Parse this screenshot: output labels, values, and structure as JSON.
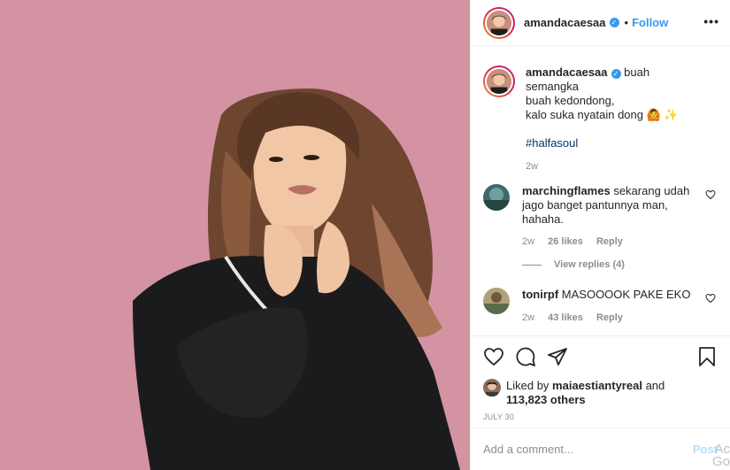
{
  "post": {
    "username": "amandacaesaa",
    "follow_label": "Follow",
    "dot": "•",
    "more_label": "•••",
    "verified_mark": "✓"
  },
  "caption": {
    "username": "amandacaesaa",
    "lines": [
      "buah semangka",
      "buah kedondong,",
      "kalo suka nyatain dong 🙆 ✨"
    ],
    "hashtag": "#halfasoul",
    "time": "2w"
  },
  "comments": [
    {
      "username": "marchingflames",
      "text": "sekarang udah jago banget pantunnya man, hahaha.",
      "time": "2w",
      "likes": "26 likes",
      "reply_label": "Reply",
      "view_replies": "View replies (4)"
    },
    {
      "username": "tonirpf",
      "text": "MASOOOOK PAKE EKO",
      "time": "2w",
      "likes": "43 likes",
      "reply_label": "Reply"
    }
  ],
  "likes": {
    "prefix": "Liked by",
    "user": "maiaestiantyreal",
    "suffix": "and",
    "others": "113,823 others"
  },
  "date": "JULY 30",
  "add_comment": {
    "placeholder": "Add a comment...",
    "post_label": "Post"
  },
  "watermark": "Ac Go",
  "icons": [
    "more-options-icon",
    "heart-icon",
    "comment-icon",
    "share-icon",
    "bookmark-icon",
    "verified-icon"
  ]
}
